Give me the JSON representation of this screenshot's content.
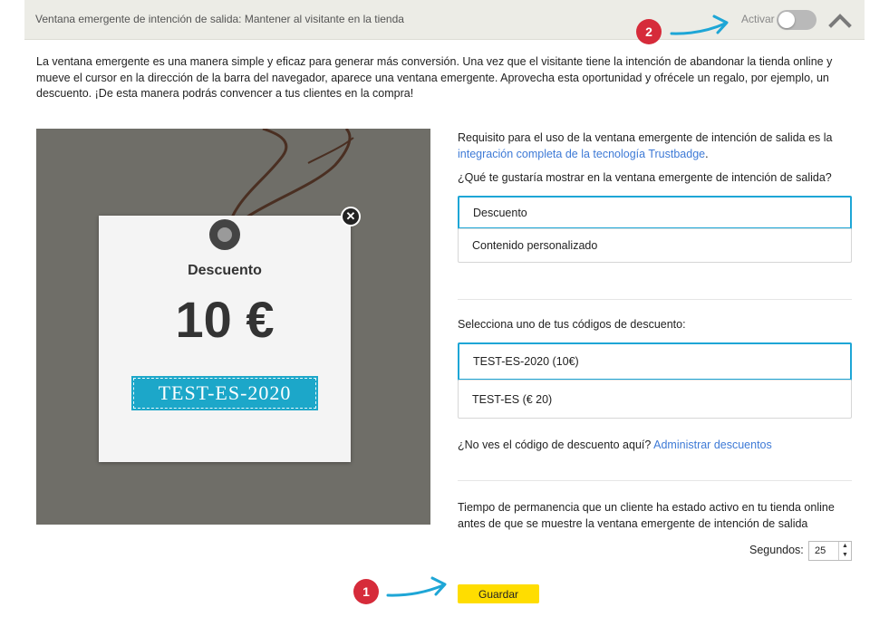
{
  "header": {
    "title": "Ventana emergente de intención de salida: Mantener al visitante en la tienda",
    "activar_label": "Activar",
    "toggle_state": "off"
  },
  "callouts": {
    "one": "1",
    "two": "2"
  },
  "intro": "La ventana emergente es una manera simple y eficaz para generar más conversión. Una vez que el visitante tiene la intención de abandonar la tienda online y mueve el cursor en la dirección de la barra del navegador, aparece una ventana emergente. Aprovecha esta oportunidad y ofrécele un regalo, por ejemplo, un descuento. ¡De esta manera podrás convencer a tus clientes en la compra!",
  "preview": {
    "title": "Descuento",
    "amount": "10 €",
    "code": "TEST-ES-2020"
  },
  "requirement": {
    "text": "Requisito para el uso de la ventana emergente de intención de salida es la",
    "link": "integración completa de la tecnología Trustbadge",
    "suffix": "."
  },
  "show_question": "¿Qué te gustaría mostrar en la ventana emergente de intención de salida?",
  "show_options": [
    "Descuento",
    "Contenido personalizado"
  ],
  "show_selected": "Descuento",
  "select_code_label": "Selecciona uno de tus códigos de descuento:",
  "codes": [
    "TEST-ES-2020 (10€)",
    "TEST-ES (€ 20)"
  ],
  "code_selected": "TEST-ES-2020 (10€)",
  "missing": {
    "text": "¿No ves el código de descuento aquí?",
    "link": "Administrar descuentos"
  },
  "time_text": "Tiempo de permanencia que un cliente ha estado activo en tu tienda online antes de que se muestre la ventana emergente de intención de salida",
  "seconds": {
    "label": "Segundos:",
    "value": "25"
  },
  "save_label": "Guardar",
  "colors": {
    "accent_blue": "#1ea6d6",
    "link": "#3e7ad6",
    "save_button": "#ffdd00",
    "badge": "#d62b3a",
    "tag_code_bg": "#1ca7c9",
    "preview_bg": "#6f6e68"
  }
}
